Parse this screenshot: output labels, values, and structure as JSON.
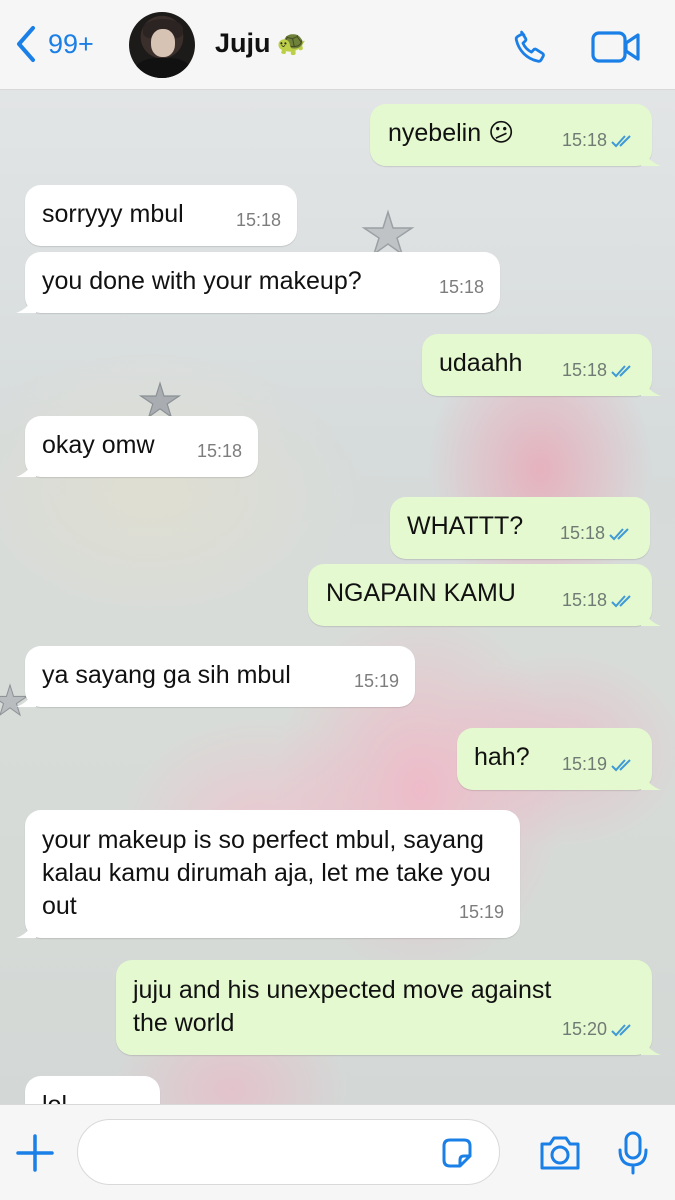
{
  "header": {
    "back_count": "99+",
    "contact_name": "Juju",
    "contact_emoji": "🐢",
    "icons": {
      "back": "chevron-left-icon",
      "call": "phone-icon",
      "video": "video-camera-icon"
    },
    "accent_color": "#1a7fe6"
  },
  "messages": [
    {
      "direction": "out",
      "text": "nyebelin 😕",
      "time": "15:18",
      "status": "read"
    },
    {
      "direction": "in",
      "text": "sorryyy mbul",
      "time": "15:18"
    },
    {
      "direction": "in",
      "text": "you done with your makeup?",
      "time": "15:18"
    },
    {
      "direction": "out",
      "text": "udaahh",
      "time": "15:18",
      "status": "read"
    },
    {
      "direction": "in",
      "text": "okay omw",
      "time": "15:18"
    },
    {
      "direction": "out",
      "text": "WHATTT?",
      "time": "15:18",
      "status": "read"
    },
    {
      "direction": "out",
      "text": "NGAPAIN KAMU",
      "time": "15:18",
      "status": "read"
    },
    {
      "direction": "in",
      "text": "ya sayang ga sih mbul",
      "time": "15:19"
    },
    {
      "direction": "out",
      "text": "hah?",
      "time": "15:19",
      "status": "read"
    },
    {
      "direction": "in",
      "text": "your makeup is so perfect mbul, sayang kalau kamu dirumah aja, let me take you out",
      "time": "15:19"
    },
    {
      "direction": "out",
      "text": "juju and his unexpected move against the world",
      "time": "15:20",
      "status": "read"
    },
    {
      "direction": "in",
      "text": "lol",
      "time": ""
    }
  ],
  "composer": {
    "value": "",
    "icons": {
      "plus": "plus-icon",
      "sticker": "sticker-icon",
      "camera": "camera-icon",
      "mic": "microphone-icon"
    }
  },
  "colors": {
    "outgoing_bubble": "#e4f9cf",
    "incoming_bubble": "#ffffff",
    "read_ticks": "#3f9ad6"
  }
}
